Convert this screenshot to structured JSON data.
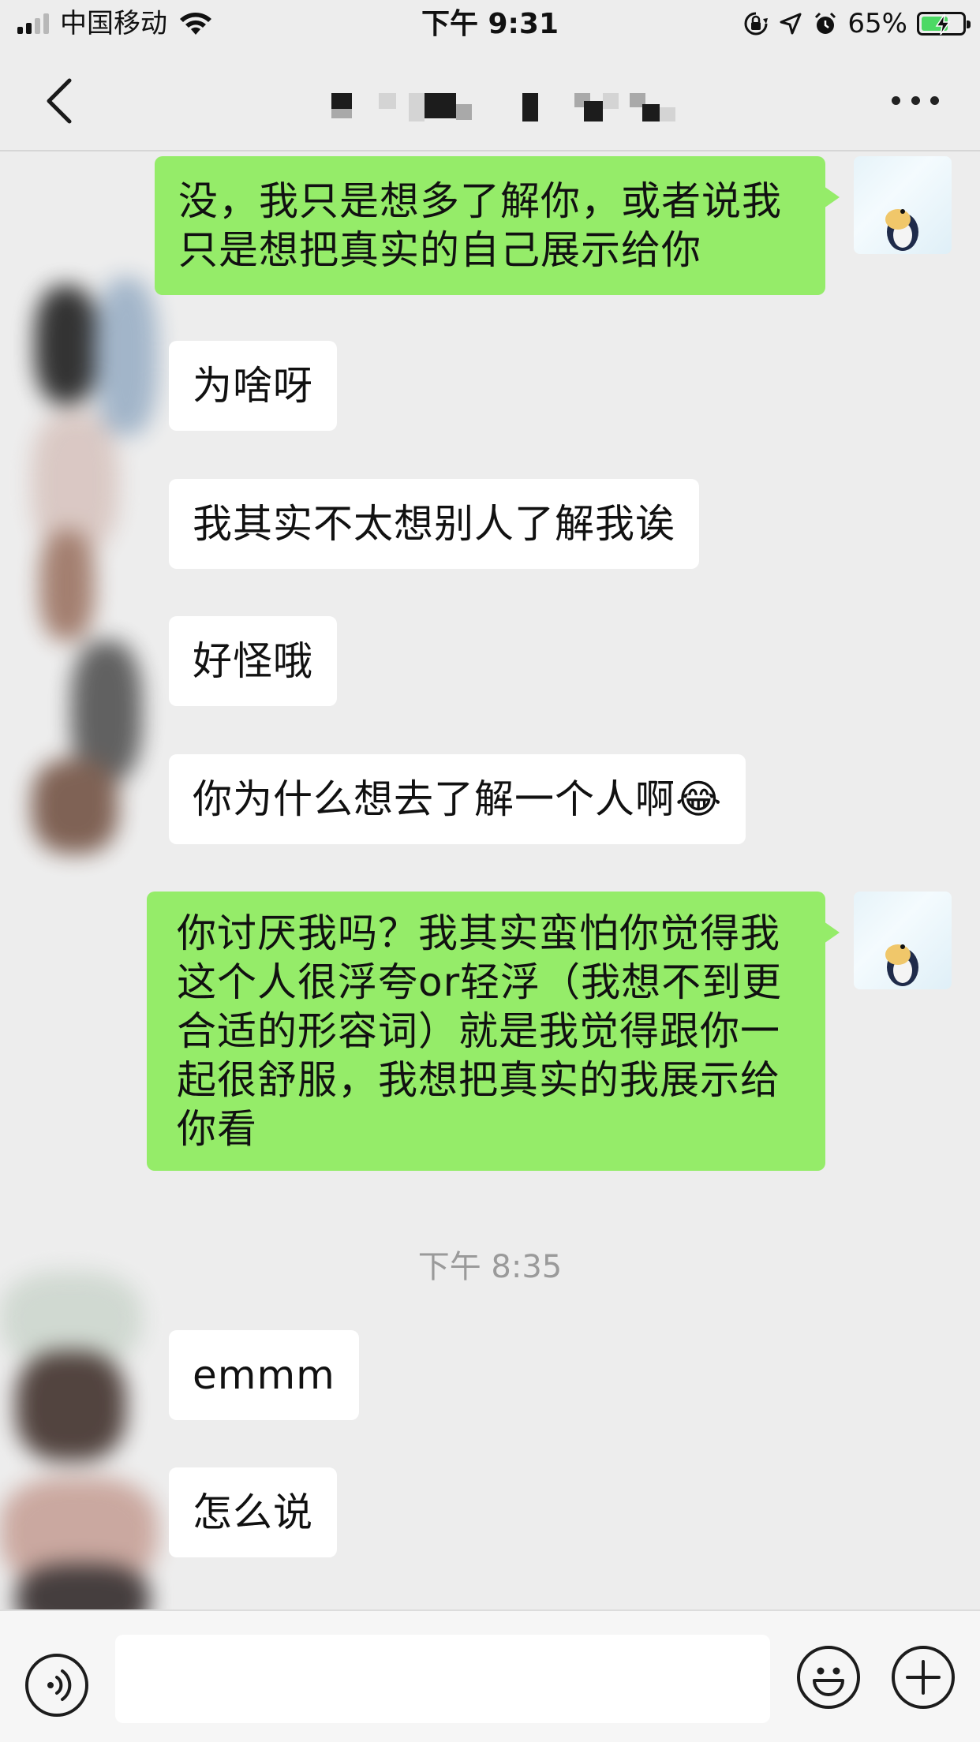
{
  "status_bar": {
    "carrier": "中国移动",
    "time": "下午 9:31",
    "battery_percent": "65%",
    "battery_level": 0.65,
    "icons": [
      "signal-icon",
      "wifi-icon",
      "orientation-lock-icon",
      "location-icon",
      "alarm-icon",
      "battery-icon"
    ]
  },
  "nav": {
    "back_icon": "chevron-left-icon",
    "more_icon": "ellipsis-icon"
  },
  "messages": [
    {
      "sender": "me",
      "text": "没，我只是想多了解你，或者说我只是想把真实的自己展示给你"
    },
    {
      "sender": "them",
      "text": "为啥呀"
    },
    {
      "sender": "them",
      "text": "我其实不太想别人了解我诶"
    },
    {
      "sender": "them",
      "text": "好怪哦"
    },
    {
      "sender": "them",
      "text": "你为什么想去了解一个人啊",
      "emoji": "😂"
    },
    {
      "sender": "me",
      "text": "你讨厌我吗？我其实蛮怕你觉得我这个人很浮夸or轻浮（我想不到更合适的形容词）就是我觉得跟你一起很舒服，我想把真实的我展示给你看"
    },
    {
      "timestamp": "下午 8:35"
    },
    {
      "sender": "them",
      "text": "emmm"
    },
    {
      "sender": "them",
      "text": "怎么说"
    }
  ],
  "input_bar": {
    "placeholder": "",
    "icons": [
      "voice-icon",
      "emoji-icon",
      "plus-icon"
    ]
  },
  "colors": {
    "background": "#ededed",
    "my_bubble": "#95ec69",
    "their_bubble": "#ffffff",
    "timestamp_text": "#9a9a9a"
  }
}
